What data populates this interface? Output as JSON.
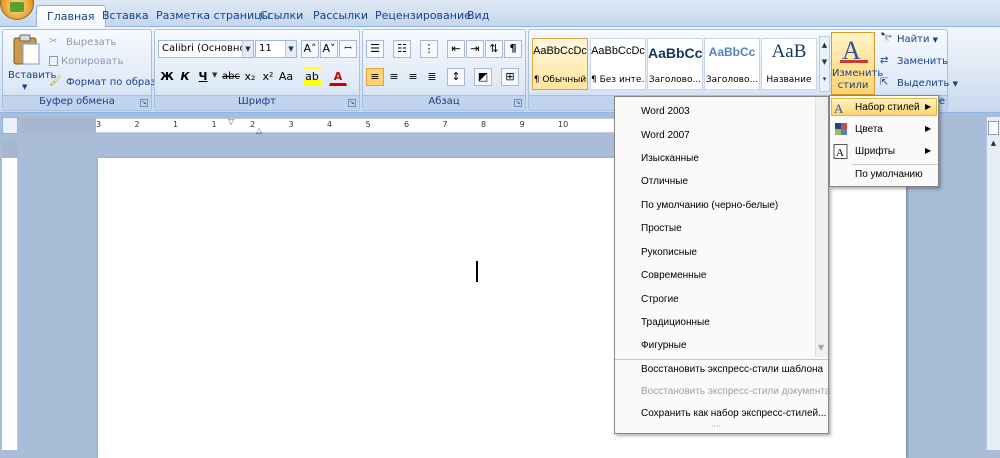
{
  "tabs": [
    {
      "label": "Главная",
      "active": true
    },
    {
      "label": "Вставка"
    },
    {
      "label": "Разметка страницы"
    },
    {
      "label": "Ссылки"
    },
    {
      "label": "Рассылки"
    },
    {
      "label": "Рецензирование"
    },
    {
      "label": "Вид"
    }
  ],
  "clipboard": {
    "paste_label": "Вставить",
    "cut_label": "Вырезать",
    "copy_label": "Копировать",
    "format_painter_label": "Формат по образцу",
    "group_label": "Буфер обмена"
  },
  "font": {
    "font_name": "Calibri (Основной те",
    "font_size": "11",
    "group_label": "Шрифт",
    "bold": "Ж",
    "italic": "К",
    "underline": "Ч",
    "strike": "abc",
    "subscript": "x₂",
    "superscript": "x²",
    "change_case": "Aa",
    "grow": "A˄",
    "shrink": "A˅",
    "clear": "A"
  },
  "paragraph": {
    "group_label": "Абзац",
    "pilcrow": "¶"
  },
  "styles": {
    "items": [
      {
        "sample": "AaBbCcDc",
        "name": "¶ Обычный",
        "selected": true
      },
      {
        "sample": "AaBbCcDc",
        "name": "¶ Без инте..."
      },
      {
        "sample": "AaBbCc",
        "name": "Заголово..."
      },
      {
        "sample": "AaBbCc",
        "name": "Заголово..."
      },
      {
        "sample": "AaB",
        "name": "Название"
      }
    ],
    "change_styles_label_1": "Изменить",
    "change_styles_label_2": "стили",
    "group_label_fragment": "е"
  },
  "editing": {
    "find_label": "Найти",
    "replace_label": "Заменить",
    "select_label": "Выделить"
  },
  "ruler": {
    "ticks": [
      "3",
      "2",
      "1",
      "1",
      "2",
      "3",
      "4",
      "5",
      "6",
      "7",
      "8",
      "9",
      "10"
    ]
  },
  "style_set_menu": {
    "items": [
      "Word 2003",
      "Word 2007",
      "Изысканные",
      "Отличные",
      "По умолчанию (черно-белые)",
      "Простые",
      "Рукописные",
      "Современные",
      "Строгие",
      "Традиционные",
      "Фигурные"
    ],
    "restore_template": "Восстановить экспресс-стили шаблона",
    "restore_document": "Восстановить экспресс-стили документа",
    "save_as": "Сохранить как набор экспресс-стилей...",
    "grip": "····"
  },
  "change_styles_menu": {
    "style_set": "Набор стилей",
    "colors": "Цвета",
    "fonts": "Шрифты",
    "default": "По умолчанию"
  },
  "colors": {
    "accent_orange": "#ffd46e",
    "ribbon_blue": "#15428b"
  }
}
